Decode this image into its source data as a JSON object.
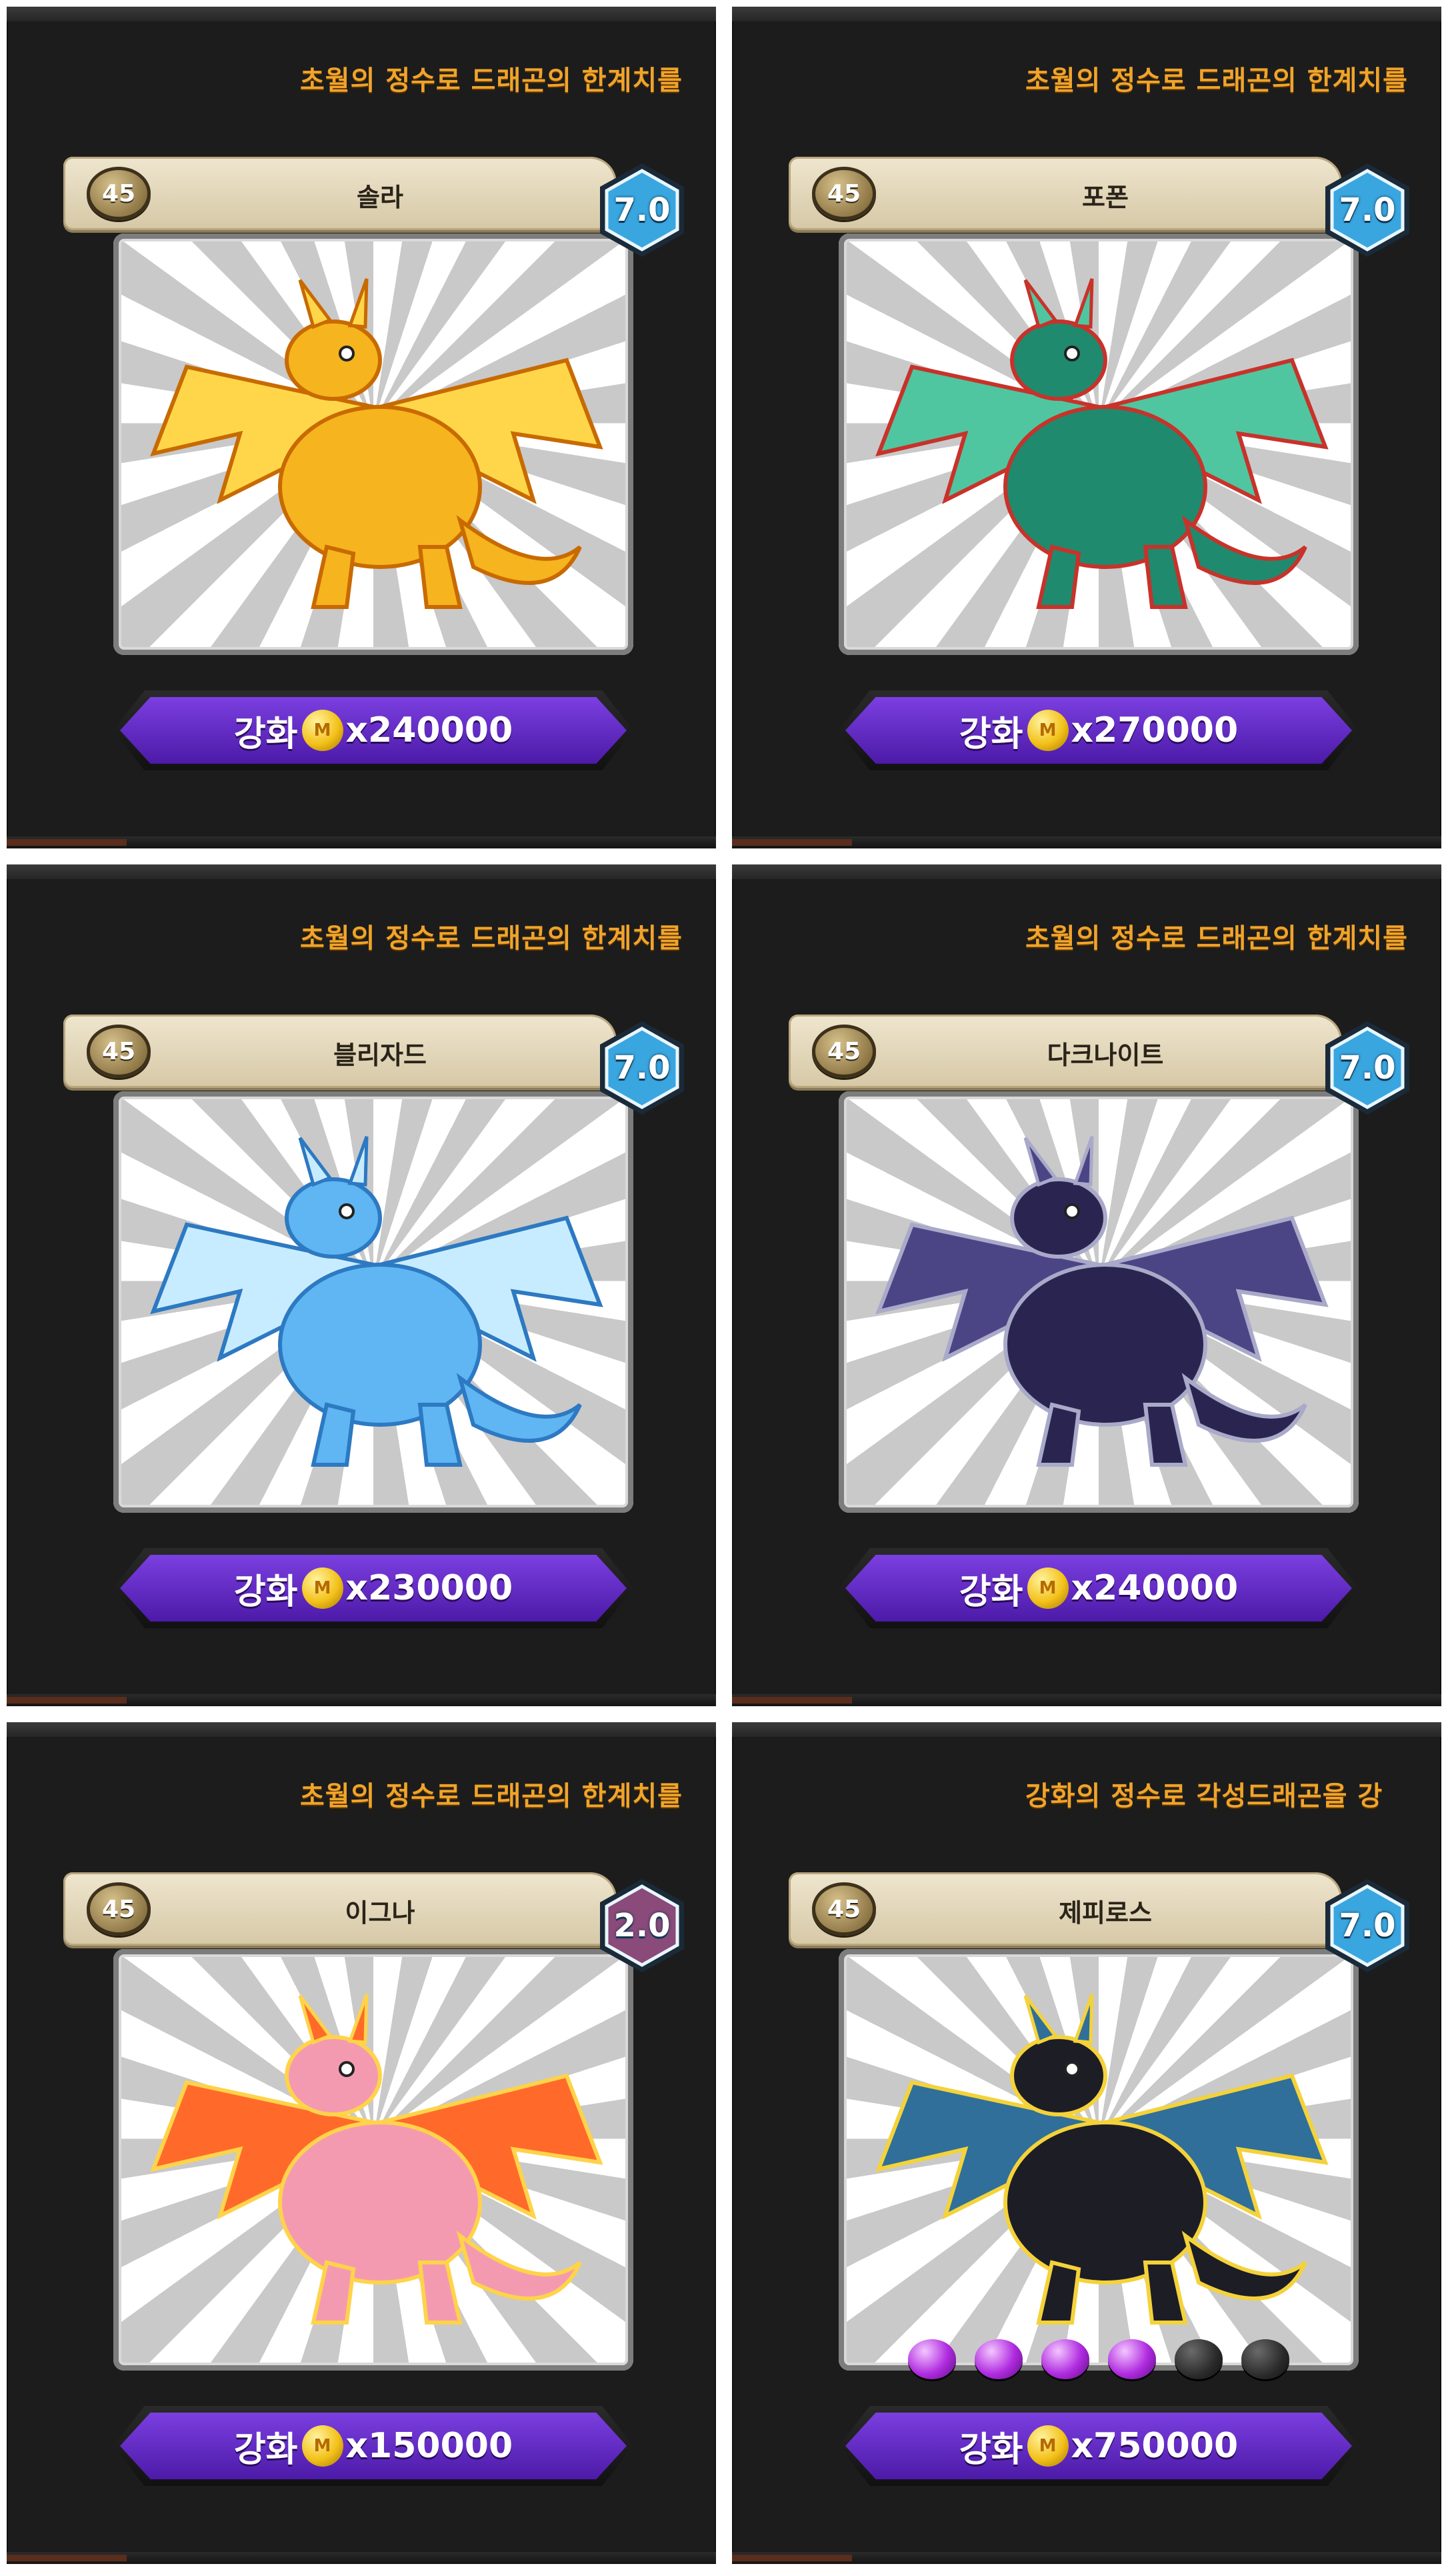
{
  "panels": [
    {
      "banner": "초월의 정수로 드래곤의 한계치를",
      "level": "45",
      "name": "솔라",
      "grade": "7.0",
      "grade_color": "#3aa6e0",
      "enhance_label": "강화",
      "cost": "x240000",
      "art_icon": "golden-dragon-icon",
      "art_colors": [
        "#f6b41e",
        "#ffd64a",
        "#c86a00"
      ]
    },
    {
      "banner": "초월의 정수로 드래곤의 한계치를",
      "level": "45",
      "name": "포폰",
      "grade": "7.0",
      "grade_color": "#3aa6e0",
      "enhance_label": "강화",
      "cost": "x270000",
      "art_icon": "green-armored-dragon-icon",
      "art_colors": [
        "#1f8a6e",
        "#4fc6a0",
        "#c8322a"
      ]
    },
    {
      "banner": "초월의 정수로 드래곤의 한계치를",
      "level": "45",
      "name": "블리자드",
      "grade": "7.0",
      "grade_color": "#3aa6e0",
      "enhance_label": "강화",
      "cost": "x230000",
      "art_icon": "ice-dragon-icon",
      "art_colors": [
        "#5fb6f2",
        "#c8ecff",
        "#2d79c2"
      ]
    },
    {
      "banner": "초월의 정수로 드래곤의 한계치를",
      "level": "45",
      "name": "다크나이트",
      "grade": "7.0",
      "grade_color": "#3aa6e0",
      "enhance_label": "강화",
      "cost": "x240000",
      "art_icon": "dark-knight-dragon-icon",
      "art_colors": [
        "#2a2550",
        "#4b4585",
        "#a9a9c9"
      ]
    },
    {
      "banner": "초월의 정수로 드래곤의 한계치를",
      "level": "45",
      "name": "이그나",
      "grade": "2.0",
      "grade_color": "#8a4a7a",
      "enhance_label": "강화",
      "cost": "x150000",
      "art_icon": "fire-pegasus-dragon-icon",
      "art_colors": [
        "#f49ab0",
        "#ff6a2a",
        "#ffd34a"
      ]
    },
    {
      "banner": "강화의 정수로 각성드래곤을 강",
      "level": "45",
      "name": "제피로스",
      "grade": "7.0",
      "grade_color": "#3aa6e0",
      "enhance_label": "강화",
      "cost": "x750000",
      "art_icon": "black-wind-dragon-icon",
      "art_colors": [
        "#1d1d26",
        "#2f6f9a",
        "#f4d23a"
      ],
      "pips": [
        true,
        true,
        true,
        true,
        false,
        false
      ]
    }
  ]
}
